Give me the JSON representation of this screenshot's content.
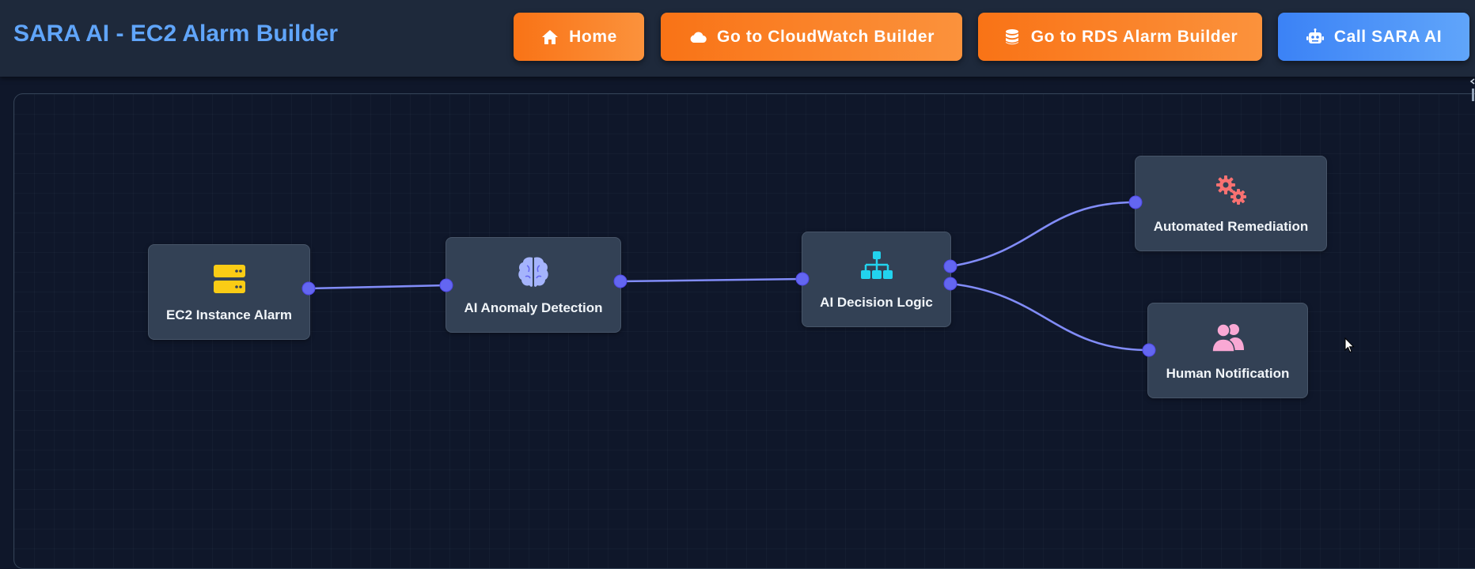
{
  "header": {
    "title": "SARA AI - EC2 Alarm Builder",
    "buttons": {
      "home": {
        "label": "Home",
        "icon": "home-icon"
      },
      "cloudwatch": {
        "label": "Go to CloudWatch Builder",
        "icon": "cloud-icon"
      },
      "rds": {
        "label": "Go to RDS Alarm Builder",
        "icon": "database-icon"
      },
      "sara": {
        "label": "Call SARA AI",
        "icon": "robot-icon"
      }
    }
  },
  "nodes": {
    "ec2": {
      "label": "EC2 Instance Alarm",
      "icon": "server-icon",
      "icon_color": "#facc15"
    },
    "anomaly": {
      "label": "AI Anomaly Detection",
      "icon": "brain-icon",
      "icon_color": "#a5b4fc"
    },
    "decision": {
      "label": "AI Decision Logic",
      "icon": "sitemap-icon",
      "icon_color": "#22d3ee"
    },
    "remediation": {
      "label": "Automated Remediation",
      "icon": "cogs-icon",
      "icon_color": "#f87171"
    },
    "notification": {
      "label": "Human Notification",
      "icon": "users-icon",
      "icon_color": "#f9a8d4"
    }
  },
  "colors": {
    "accent_orange": "#f97316",
    "accent_blue": "#3b82f6",
    "title": "#60a5fa",
    "edge": "#818cf8",
    "port": "#6366f1"
  }
}
